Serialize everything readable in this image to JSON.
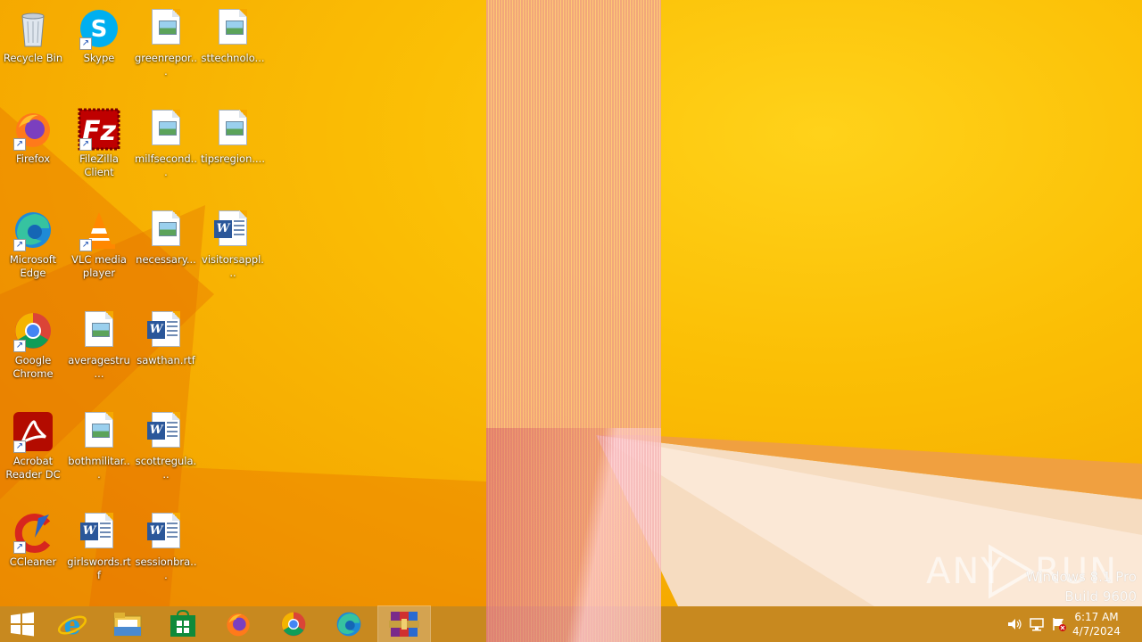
{
  "desktop_icons": [
    {
      "label": "Recycle Bin"
    },
    {
      "label": "Skype"
    },
    {
      "label": "greenrepor..."
    },
    {
      "label": "sttechnolo..."
    },
    {
      "label": "Firefox"
    },
    {
      "label": "FileZilla Client"
    },
    {
      "label": "milfsecond..."
    },
    {
      "label": "tipsregion...."
    },
    {
      "label": "Microsoft Edge"
    },
    {
      "label": "VLC media player"
    },
    {
      "label": "necessary..."
    },
    {
      "label": "visitorsappl..."
    },
    {
      "label": "Google Chrome"
    },
    {
      "label": "averagestru..."
    },
    {
      "label": "sawthan.rtf"
    },
    {
      "label": "Acrobat Reader DC"
    },
    {
      "label": "bothmilitar..."
    },
    {
      "label": "scottregula..."
    },
    {
      "label": "CCleaner"
    },
    {
      "label": "girlswords.rtf"
    },
    {
      "label": "sessionbra..."
    }
  ],
  "taskbar": {
    "items": [
      {
        "icon": "windows-start-icon"
      },
      {
        "icon": "internet-explorer-icon"
      },
      {
        "icon": "file-explorer-icon"
      },
      {
        "icon": "windows-store-icon"
      },
      {
        "icon": "firefox-icon"
      },
      {
        "icon": "chrome-icon"
      },
      {
        "icon": "edge-icon"
      },
      {
        "icon": "winrar-icon",
        "active": true
      }
    ],
    "tray": [
      "speaker-icon",
      "network-icon",
      "action-center-flag-icon"
    ]
  },
  "clock": {
    "time": "6:17 AM",
    "date": "4/7/2024"
  },
  "watermark": {
    "line1": "Windows 8.1 Pro",
    "line2": "Build 9600"
  },
  "anyrun_logo": {
    "text_left": "ANY",
    "text_right": "RUN"
  },
  "colors": {
    "wallpaper": "#f7b200",
    "taskbar": "#c8891f",
    "glitch": "#f0a096"
  }
}
